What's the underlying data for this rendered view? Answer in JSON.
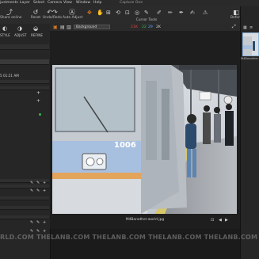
{
  "menu": {
    "items": [
      "justments",
      "Layer",
      "Select",
      "Camera",
      "View",
      "Window",
      "Help"
    ],
    "app_title": "Capture One"
  },
  "toolbar": {
    "share_label": "Share online",
    "reset_label": "Reset",
    "undo_redo_label": "Undo/Redo",
    "auto_adjust_label": "Auto Adjust",
    "cursor_tools_label": "Cursor Tools",
    "before_label": "Before",
    "grid_label": "Grid"
  },
  "left_panel": {
    "tabs": [
      "STYLE",
      "ADJUST",
      "REFINE"
    ],
    "timestamp": "5 01:21 AM"
  },
  "viewer": {
    "background_select": "Background",
    "rgbk": {
      "r": "21K",
      "g": "22",
      "b": "29",
      "k": "2K"
    },
    "filename": "M4Banother-world.jpg",
    "watermark": "RLD.COM THELANB.COM THELANB.COM THELANB.COM THELANB.COM THELANB.COM THELANB.COM THELANB.COM"
  },
  "photo": {
    "train_number": "1006"
  },
  "right_panel": {
    "thumb_label": "M4Banother"
  },
  "colors": {
    "accent_orange": "#e07b1a",
    "rgb_red": "#e04a3c",
    "rgb_green": "#3fbf4f",
    "rgb_blue": "#5aa0ff",
    "panel_bg": "#262626"
  }
}
